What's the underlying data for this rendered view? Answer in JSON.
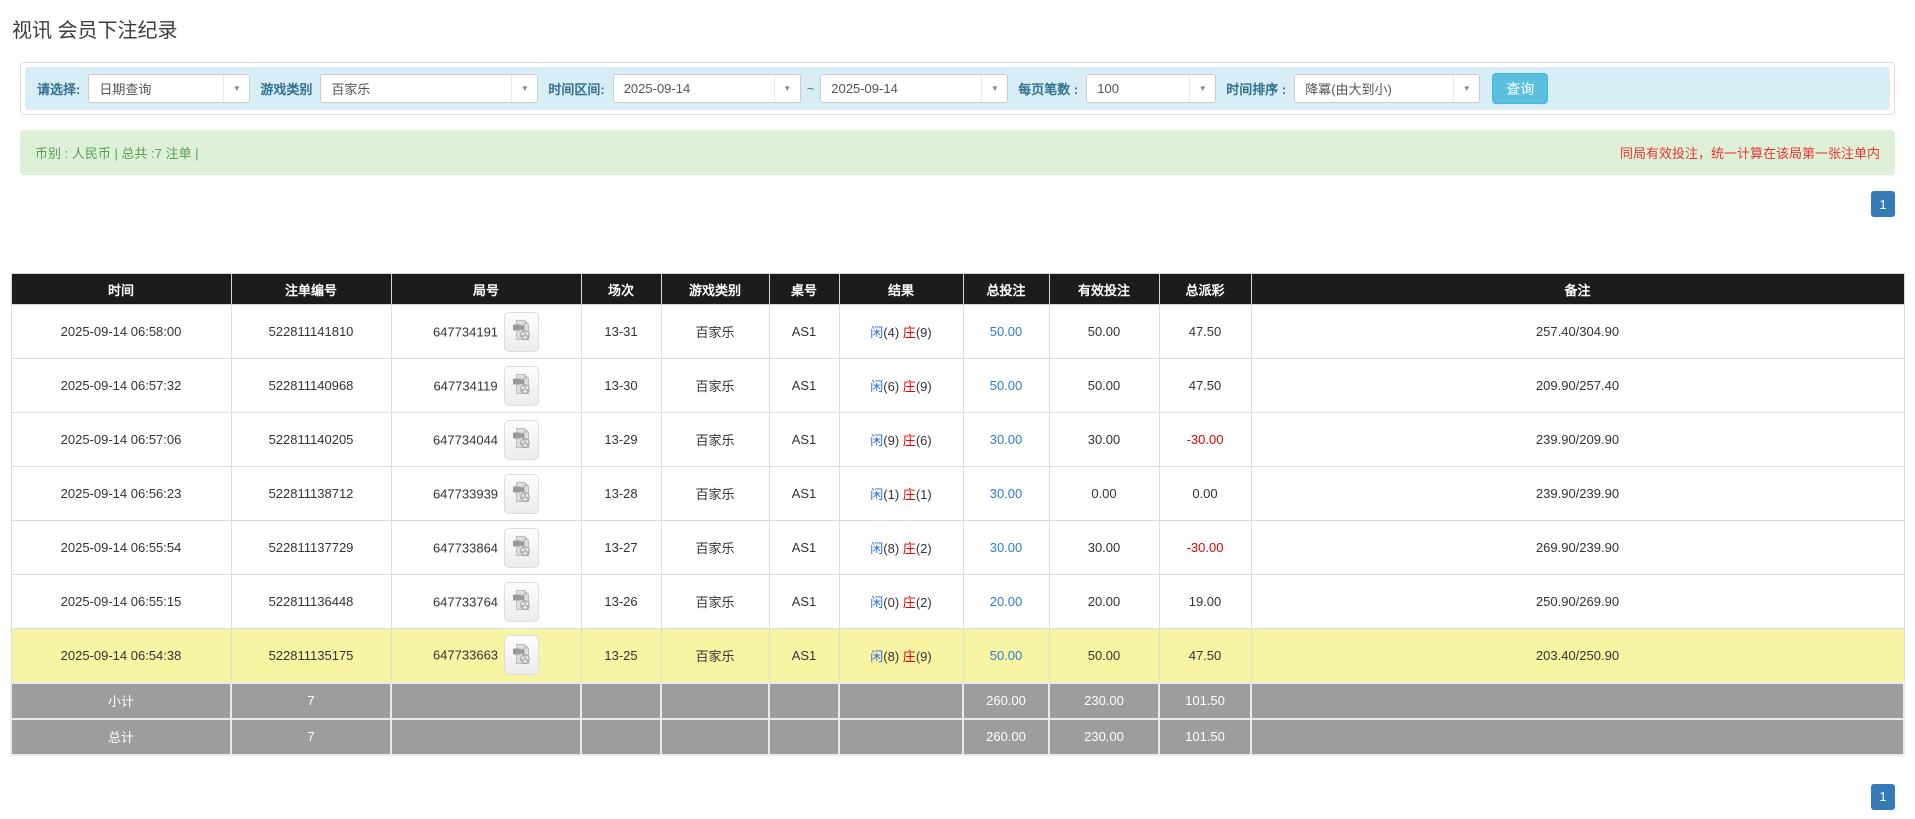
{
  "page": {
    "title": "视讯 会员下注纪录"
  },
  "colors": {
    "accent_blue": "#337ab7",
    "info_bg": "#d9edf7",
    "success_bg": "#dff0d8",
    "button_blue": "#5bc0de",
    "header_black": "#1c1c1c",
    "highlight_yellow": "#f7f5a3",
    "footer_gray": "#9d9d9d",
    "player_blue": "#2f6dd8",
    "banker_red": "#e60000",
    "negative_red": "#ee0000"
  },
  "filters": {
    "select_label": "请选择:",
    "select_value": "日期查询",
    "game_type_label": "游戏类别",
    "game_type_value": "百家乐",
    "date_range_label": "时间区间:",
    "date_from": "2025-09-14",
    "tilde": "~",
    "date_to": "2025-09-14",
    "page_size_label": "每页笔数 :",
    "page_size_value": "100",
    "sort_label": "时间排序 :",
    "sort_value": "降冪(由大到小)",
    "search_button": "查询",
    "dropdown_icon": "chevron-down-icon"
  },
  "summary": {
    "left": "币别 : 人民币 | 总共 :7 注单 |",
    "right": "同局有效投注，统一计算在该局第一张注单内"
  },
  "pagination": {
    "page": "1"
  },
  "icons": {
    "round_video": "video-replay-icon"
  },
  "table": {
    "headers": [
      "时间",
      "注单编号",
      "局号",
      "场次",
      "游戏类别",
      "桌号",
      "结果",
      "总投注",
      "有效投注",
      "总派彩",
      "备注"
    ],
    "result_labels": {
      "player": "闲",
      "banker": "庄"
    },
    "rows": [
      {
        "time": "2025-09-14 06:58:00",
        "bet_id": "522811141810",
        "round": "647734191",
        "session": "13-31",
        "game": "百家乐",
        "table": "AS1",
        "player": "4",
        "banker": "9",
        "total_bet": "50.00",
        "valid_bet": "50.00",
        "payout": "47.50",
        "note": "257.40/304.90",
        "highlight": false
      },
      {
        "time": "2025-09-14 06:57:32",
        "bet_id": "522811140968",
        "round": "647734119",
        "session": "13-30",
        "game": "百家乐",
        "table": "AS1",
        "player": "6",
        "banker": "9",
        "total_bet": "50.00",
        "valid_bet": "50.00",
        "payout": "47.50",
        "note": "209.90/257.40",
        "highlight": false
      },
      {
        "time": "2025-09-14 06:57:06",
        "bet_id": "522811140205",
        "round": "647734044",
        "session": "13-29",
        "game": "百家乐",
        "table": "AS1",
        "player": "9",
        "banker": "6",
        "total_bet": "30.00",
        "valid_bet": "30.00",
        "payout": "-30.00",
        "note": "239.90/209.90",
        "highlight": false
      },
      {
        "time": "2025-09-14 06:56:23",
        "bet_id": "522811138712",
        "round": "647733939",
        "session": "13-28",
        "game": "百家乐",
        "table": "AS1",
        "player": "1",
        "banker": "1",
        "total_bet": "30.00",
        "valid_bet": "0.00",
        "payout": "0.00",
        "note": "239.90/239.90",
        "highlight": false
      },
      {
        "time": "2025-09-14 06:55:54",
        "bet_id": "522811137729",
        "round": "647733864",
        "session": "13-27",
        "game": "百家乐",
        "table": "AS1",
        "player": "8",
        "banker": "2",
        "total_bet": "30.00",
        "valid_bet": "30.00",
        "payout": "-30.00",
        "note": "269.90/239.90",
        "highlight": false
      },
      {
        "time": "2025-09-14 06:55:15",
        "bet_id": "522811136448",
        "round": "647733764",
        "session": "13-26",
        "game": "百家乐",
        "table": "AS1",
        "player": "0",
        "banker": "2",
        "total_bet": "20.00",
        "valid_bet": "20.00",
        "payout": "19.00",
        "note": "250.90/269.90",
        "highlight": false
      },
      {
        "time": "2025-09-14 06:54:38",
        "bet_id": "522811135175",
        "round": "647733663",
        "session": "13-25",
        "game": "百家乐",
        "table": "AS1",
        "player": "8",
        "banker": "9",
        "total_bet": "50.00",
        "valid_bet": "50.00",
        "payout": "47.50",
        "note": "203.40/250.90",
        "highlight": true
      }
    ],
    "footers": [
      {
        "label": "小计",
        "count": "7",
        "total_bet": "260.00",
        "valid_bet": "230.00",
        "payout": "101.50"
      },
      {
        "label": "总计",
        "count": "7",
        "total_bet": "260.00",
        "valid_bet": "230.00",
        "payout": "101.50"
      }
    ]
  }
}
